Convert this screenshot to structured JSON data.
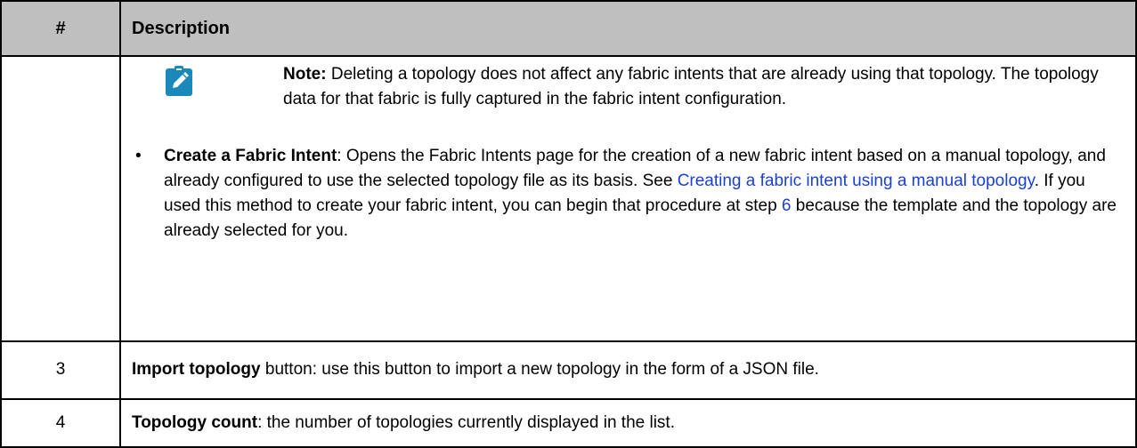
{
  "table": {
    "header": {
      "num": "#",
      "description": "Description"
    },
    "row_main": {
      "num": "",
      "note": {
        "icon": "pencil-clipboard-icon",
        "label": "Note:",
        "text": " Deleting a topology does not affect any fabric intents that are already using that topology. The topology data for that fabric is fully captured in the fabric intent configuration."
      },
      "bullet": {
        "mark": "•",
        "title": "Create a Fabric Intent",
        "text_1": ": Opens the Fabric Intents page for the creation of a new fabric intent based on a manual topology, and already configured to use the selected topology file as its basis. See ",
        "link_1": "Creating a fabric intent using a manual topology",
        "text_2": ". If you used this method to create your fabric intent, you can begin that procedure at step ",
        "link_2": "6",
        "text_3": " because the template and the topology are already selected for you."
      }
    },
    "row_3": {
      "num": "3",
      "title": "Import topology",
      "text": " button: use this button to import a new topology in the form of a JSON file."
    },
    "row_4": {
      "num": "4",
      "title": "Topology count",
      "text": ": the number of topologies currently displayed in the list."
    }
  },
  "colors": {
    "header_bg": "#bfbfbf",
    "icon_bg": "#1a88b8",
    "link": "#1a3fd6"
  }
}
